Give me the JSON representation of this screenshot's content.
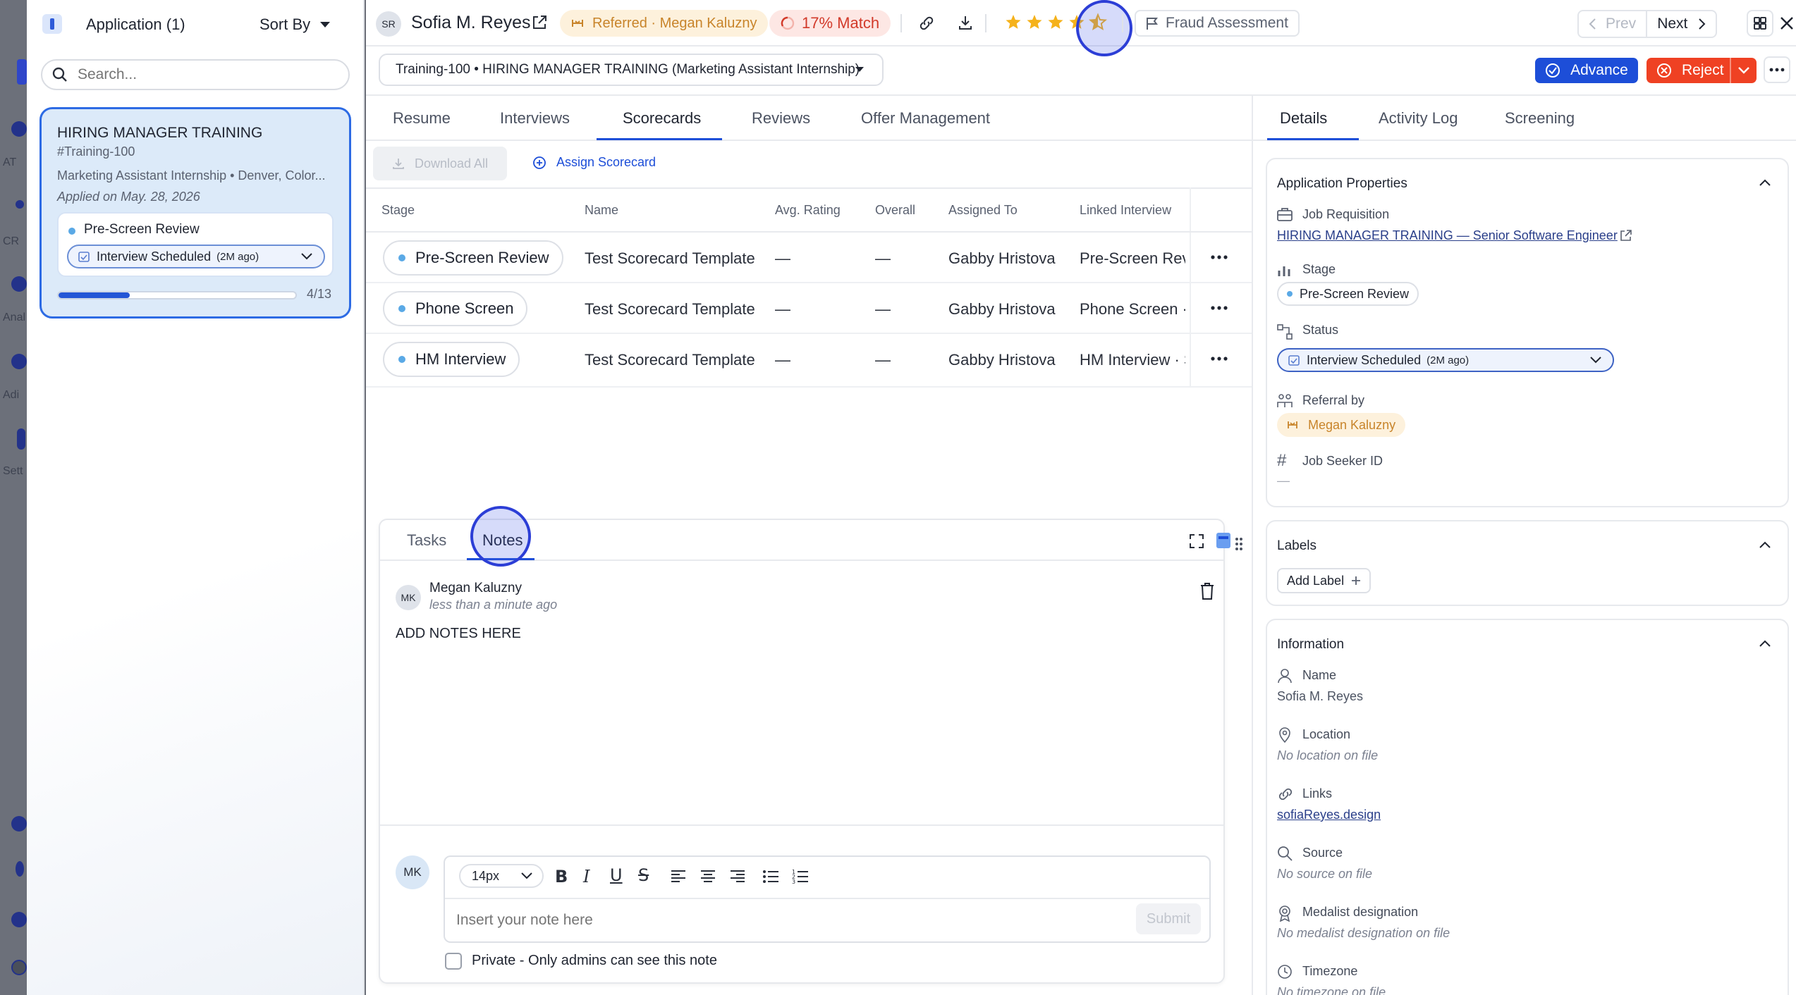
{
  "left_strip": {
    "labels": [
      "AT",
      "CR",
      "Anal",
      "Adi",
      "Sett"
    ]
  },
  "left_panel": {
    "title": "Application (1)",
    "sort_label": "Sort By",
    "search_placeholder": "Search...",
    "card": {
      "title": "HIRING MANAGER TRAINING",
      "code": "#Training-100",
      "subtitle": "Marketing Assistant Internship • Denver, Color...",
      "applied": "Applied on May. 28, 2026",
      "stage": "Pre-Screen Review",
      "status": "Interview Scheduled",
      "status_age": "(2M ago)",
      "progress_text": "4/13",
      "progress_fraction": 0.3
    }
  },
  "header": {
    "avatar_initials": "SR",
    "candidate_name": "Sofia M. Reyes",
    "referral_badge": "Referred · Megan Kaluzny",
    "match_badge": "17% Match",
    "rating": 4.5,
    "fraud_label": "Fraud Assessment",
    "prev_label": "Prev",
    "next_label": "Next"
  },
  "job_select": {
    "value": "Training-100 • HIRING MANAGER TRAINING (Marketing Assistant Internship)"
  },
  "actions": {
    "advance_label": "Advance",
    "reject_label": "Reject"
  },
  "tabs": {
    "items": [
      "Resume",
      "Interviews",
      "Scorecards",
      "Reviews",
      "Offer Management"
    ],
    "active": "Scorecards"
  },
  "scorecards": {
    "download_all": "Download All",
    "assign_scorecard": "Assign Scorecard",
    "columns": [
      "Stage",
      "Name",
      "Avg. Rating",
      "Overall",
      "Assigned To",
      "Linked Interview"
    ],
    "rows": [
      {
        "stage": "Pre-Screen Review",
        "name": "Test Scorecard Template",
        "avg": "—",
        "overall": "—",
        "assigned": "Gabby Hristova",
        "linked": "Pre-Screen Revie"
      },
      {
        "stage": "Phone Screen",
        "name": "Test Scorecard Template",
        "avg": "—",
        "overall": "—",
        "assigned": "Gabby Hristova",
        "linked": "Phone Screen · Ju"
      },
      {
        "stage": "HM Interview",
        "name": "Test Scorecard Template",
        "avg": "—",
        "overall": "—",
        "assigned": "Gabby Hristova",
        "linked": "HM Interview · Se"
      }
    ]
  },
  "notes_panel": {
    "tabs": [
      "Tasks",
      "Notes"
    ],
    "active": "Notes",
    "note": {
      "author_initials": "MK",
      "author": "Megan Kaluzny",
      "time": "less than a minute ago",
      "body": "ADD NOTES HERE"
    },
    "composer": {
      "avatar_initials": "MK",
      "font_size": "14px",
      "placeholder": "Insert your note here",
      "submit_label": "Submit",
      "private_label": "Private - Only admins can see this note"
    }
  },
  "right_panel": {
    "tabs": [
      "Details",
      "Activity Log",
      "Screening"
    ],
    "active": "Details",
    "app_props": {
      "title": "Application Properties",
      "job_req_label": "Job Requisition",
      "job_req_value": "HIRING MANAGER TRAINING — Senior Software Engineer",
      "stage_label": "Stage",
      "stage_value": "Pre-Screen Review",
      "status_label": "Status",
      "status_value": "Interview Scheduled",
      "status_age": "(2M ago)",
      "referral_label": "Referral by",
      "referral_value": "Megan Kaluzny",
      "seeker_label": "Job Seeker ID",
      "seeker_value": "—"
    },
    "labels": {
      "title": "Labels",
      "add_label": "Add Label"
    },
    "information": {
      "title": "Information",
      "name_label": "Name",
      "name_value": "Sofia M. Reyes",
      "location_label": "Location",
      "location_value": "No location on file",
      "links_label": "Links",
      "links_value": "sofiaReyes.design",
      "source_label": "Source",
      "source_value": "No source on file",
      "medalist_label": "Medalist designation",
      "medalist_value": "No medalist designation on file",
      "timezone_label": "Timezone",
      "timezone_value": "No timezone on file"
    }
  },
  "colors": {
    "primary": "#1d4ed8",
    "danger": "#ef4123",
    "referral_bg": "#fdf1dc",
    "referral_text": "#c8842a",
    "match_bg": "#fde7e4",
    "match_text": "#d23a2a",
    "card_bg": "#dceaf9",
    "star": "#f5b21b"
  }
}
